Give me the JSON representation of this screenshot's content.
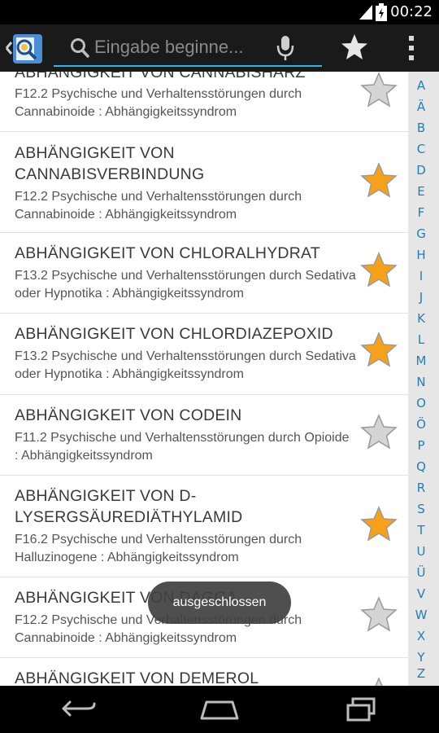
{
  "status_bar": {
    "time": "00:22",
    "icons": [
      "signal-icon",
      "battery-icon"
    ]
  },
  "action_bar": {
    "app_icon": "dictionary-app-icon",
    "search": {
      "placeholder": "Eingabe beginne..."
    },
    "icons": [
      "search-icon",
      "microphone-icon",
      "favorites-star-icon",
      "overflow-menu-icon"
    ],
    "accent_color": "#33b5e5"
  },
  "list": {
    "items": [
      {
        "title": "ABHÄNGIGKEIT VON CANNABISHARZ",
        "description": "F12.2 Psychische und Verhaltensstörungen durch Cannabinoide : Abhängigkeitssyndrom",
        "favorite": false
      },
      {
        "title": "ABHÄNGIGKEIT VON CANNABISVERBINDUNG",
        "description": "F12.2 Psychische und Verhaltensstörungen durch Cannabinoide : Abhängigkeitssyndrom",
        "favorite": true
      },
      {
        "title": "ABHÄNGIGKEIT VON CHLORALHYDRAT",
        "description": "F13.2 Psychische und Verhaltensstörungen durch Sedativa oder Hypnotika : Abhängigkeitssyndrom",
        "favorite": true
      },
      {
        "title": "ABHÄNGIGKEIT VON CHLORDIAZEPOXID",
        "description": "F13.2 Psychische und Verhaltensstörungen durch Sedativa oder Hypnotika : Abhängigkeitssyndrom",
        "favorite": true
      },
      {
        "title": "ABHÄNGIGKEIT VON CODEIN",
        "description": "F11.2 Psychische und Verhaltensstörungen durch Opioide : Abhängigkeitssyndrom",
        "favorite": false
      },
      {
        "title": "ABHÄNGIGKEIT VON D-LYSERGSÄUREDIÄTHYLAMID",
        "description": "F16.2 Psychische und Verhaltensstörungen durch Halluzinogene : Abhängigkeitssyndrom",
        "favorite": true
      },
      {
        "title": "ABHÄNGIGKEIT VON DAGGA",
        "description": "F12.2 Psychische und Verhaltensstörungen durch Cannabinoide : Abhängigkeitssyndrom",
        "favorite": false
      },
      {
        "title": "ABHÄNGIGKEIT VON DEMEROL",
        "description": "",
        "favorite": false
      }
    ]
  },
  "alphabet_index": [
    "A",
    "Ä",
    "B",
    "C",
    "D",
    "E",
    "F",
    "G",
    "H",
    "I",
    "J",
    "K",
    "L",
    "M",
    "N",
    "O",
    "Ö",
    "P",
    "Q",
    "R",
    "S",
    "T",
    "U",
    "Ü",
    "V",
    "W",
    "X",
    "Y",
    "Z"
  ],
  "toast": {
    "text": "ausgeschlossen"
  },
  "nav_bar": {
    "icons": [
      "back-icon",
      "home-icon",
      "recent-apps-icon"
    ]
  },
  "colors": {
    "favorite_star": "#f7a11a",
    "unfavorite_star": "#c9c9c9",
    "index_text": "#1f7fb8"
  }
}
